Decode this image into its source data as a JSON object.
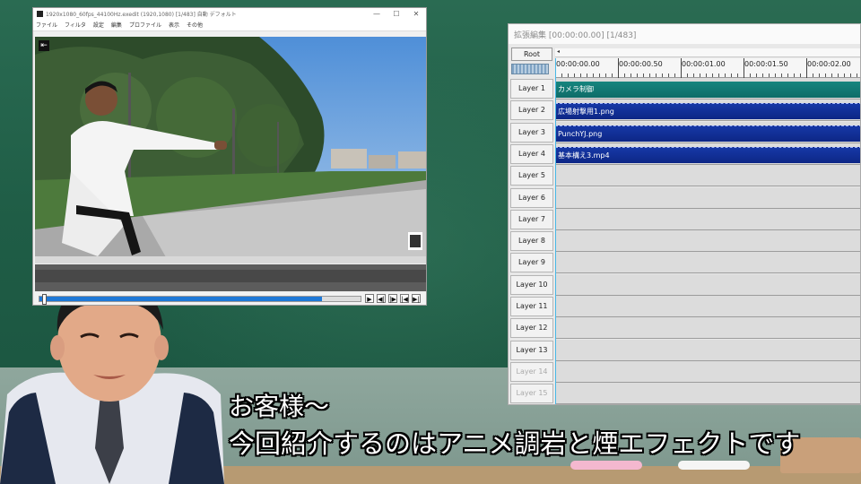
{
  "preview_window": {
    "title": "1920x1080_60fps_44100Hz.exedit (1920,1080) [1/483] 自動 デフォルト",
    "window_buttons": [
      "—",
      "☐",
      "✕"
    ],
    "menu": [
      "ファイル",
      "フィルタ",
      "設定",
      "編集",
      "プロファイル",
      "表示",
      "その他"
    ],
    "controls": [
      "▶",
      "◀|",
      "|▶",
      "|◀",
      "▶|"
    ],
    "seek_progress": 0.88
  },
  "timeline_window": {
    "title": "拡張編集 [00:00:00.00] [1/483]",
    "root_label": "Root",
    "scroll_marker": "◂",
    "ruler": [
      "00:00:00.00",
      "00:00:00.50",
      "00:00:01.00",
      "00:00:01.50",
      "00:00:02.00"
    ],
    "layers": [
      {
        "label": "Layer 1",
        "clip": "カメラ制御",
        "clip_color": "teal"
      },
      {
        "label": "Layer 2",
        "clip": "広場射撃用1.png",
        "clip_color": "blue"
      },
      {
        "label": "Layer 3",
        "clip": "PunchYJ.png",
        "clip_color": "blue"
      },
      {
        "label": "Layer 4",
        "clip": "基本構え3.mp4",
        "clip_color": "blue"
      },
      {
        "label": "Layer 5",
        "clip": ""
      },
      {
        "label": "Layer 6",
        "clip": ""
      },
      {
        "label": "Layer 7",
        "clip": ""
      },
      {
        "label": "Layer 8",
        "clip": ""
      },
      {
        "label": "Layer 9",
        "clip": ""
      },
      {
        "label": "Layer 10",
        "clip": ""
      },
      {
        "label": "Layer 11",
        "clip": ""
      },
      {
        "label": "Layer 12",
        "clip": ""
      },
      {
        "label": "Layer 13",
        "clip": ""
      },
      {
        "label": "Layer 14",
        "clip": "",
        "dim": true
      },
      {
        "label": "Layer 15",
        "clip": "",
        "dim": true
      }
    ]
  },
  "subtitle": {
    "line1": "お客様〜",
    "line2": "今回紹介するのはアニメ調岩と煙エフェクトです"
  },
  "colors": {
    "background": "#1f5a44",
    "clip_teal": "#13817c",
    "clip_blue": "#1236a0",
    "seek_fill": "#1e78d7"
  },
  "icons": [
    "back-arrow-icon",
    "play-icon",
    "prev-frame-icon",
    "next-frame-icon",
    "go-start-icon",
    "go-end-icon",
    "app-icon"
  ]
}
